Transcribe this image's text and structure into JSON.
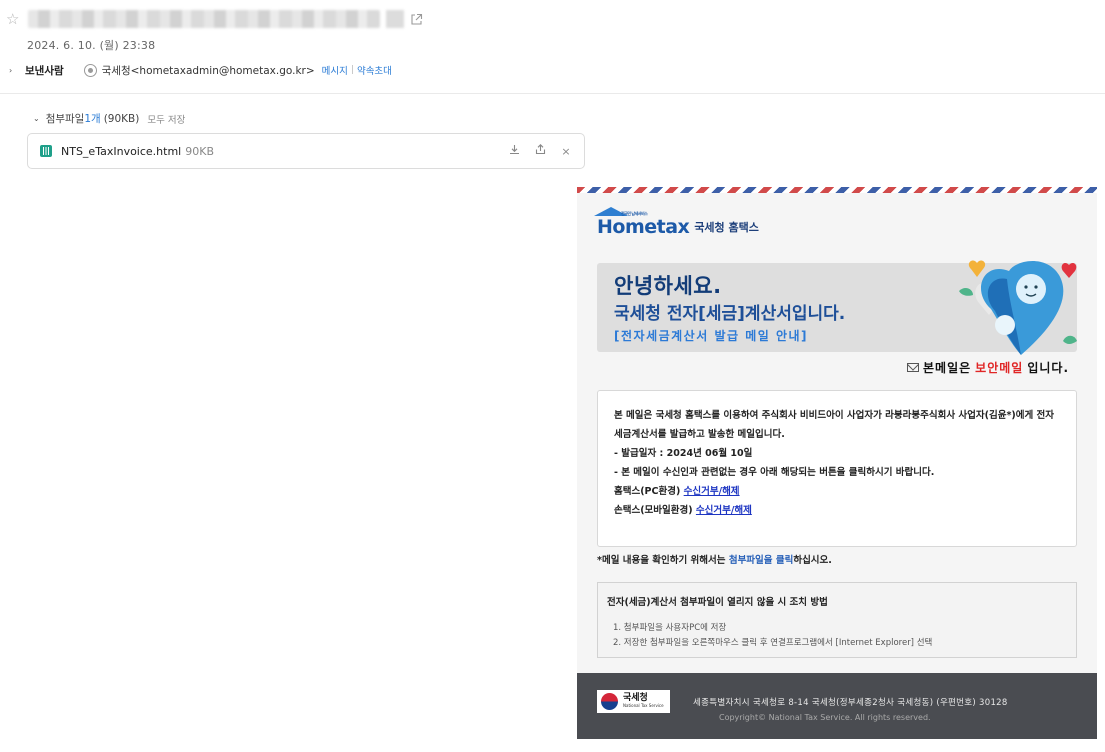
{
  "header": {
    "date": "2024. 6. 10. (월) 23:38",
    "sender_label": "보낸사람",
    "sender": "국세청<hometaxadmin@hometax.go.kr>",
    "message_link": "메시지",
    "appointment_link": "약속초대"
  },
  "attachments": {
    "label": "첨부파일",
    "count": "1개",
    "size": "(90KB)",
    "save_all": "모두 저장",
    "file": {
      "name": "NTS_eTaxInvoice.html",
      "size": "90KB"
    }
  },
  "mail": {
    "logo_word": "Hometax",
    "logo_small": "전국민 납세서비스",
    "logo_ko": "국세청 홈택스",
    "hero_line1": "안녕하세요.",
    "hero_line2": "국세청 전자[세금]계산서입니다.",
    "hero_line3": "[전자세금계산서 발급 메일 안내]",
    "secure_pre": "본메일은",
    "secure_red": "보안메일",
    "secure_post": "입니다.",
    "info_para": "본 메일은 국세청 홈택스를 이용하여 주식회사 비비드아이 사업자가 라붕라붕주식회사 사업자(김윤*)에게 전자세금계산서를 발급하고 발송한 메일입니다.",
    "info_date": "- 발급일자 : 2024년 06월 10일",
    "info_notice": "- 본 메일이 수신인과 관련없는 경우 아래 해당되는 버튼을 클릭하시기 바랍니다.",
    "pc_label": "홈택스(PC환경)",
    "pc_link": "수신거부/해제",
    "mobile_label": "손택스(모바일환경)",
    "mobile_link": "수신거부/해제",
    "note_pre": "*메일 내용을 확인하기 위해서는",
    "note_hl": "첨부파일을 클릭",
    "note_post": "하십시오.",
    "guide_title": "전자(세금)계산서 첨부파일이 열리지 않을 시 조치 방법",
    "guide_items": [
      "1. 첨부파일을 사용자PC에 저장",
      "2. 저장한 첨부파일을 오른쪽마우스 클릭 후 연결프로그램에서 [Internet Explorer] 선택"
    ],
    "footer_logo_ko": "국세청",
    "footer_logo_en": "National Tax Service",
    "footer_address": "세종특별자치시 국세청로 8-14 국세청(정부세종2청사 국세청동) (우편번호) 30128",
    "footer_copyright": "Copyright© National Tax Service. All rights reserved."
  }
}
